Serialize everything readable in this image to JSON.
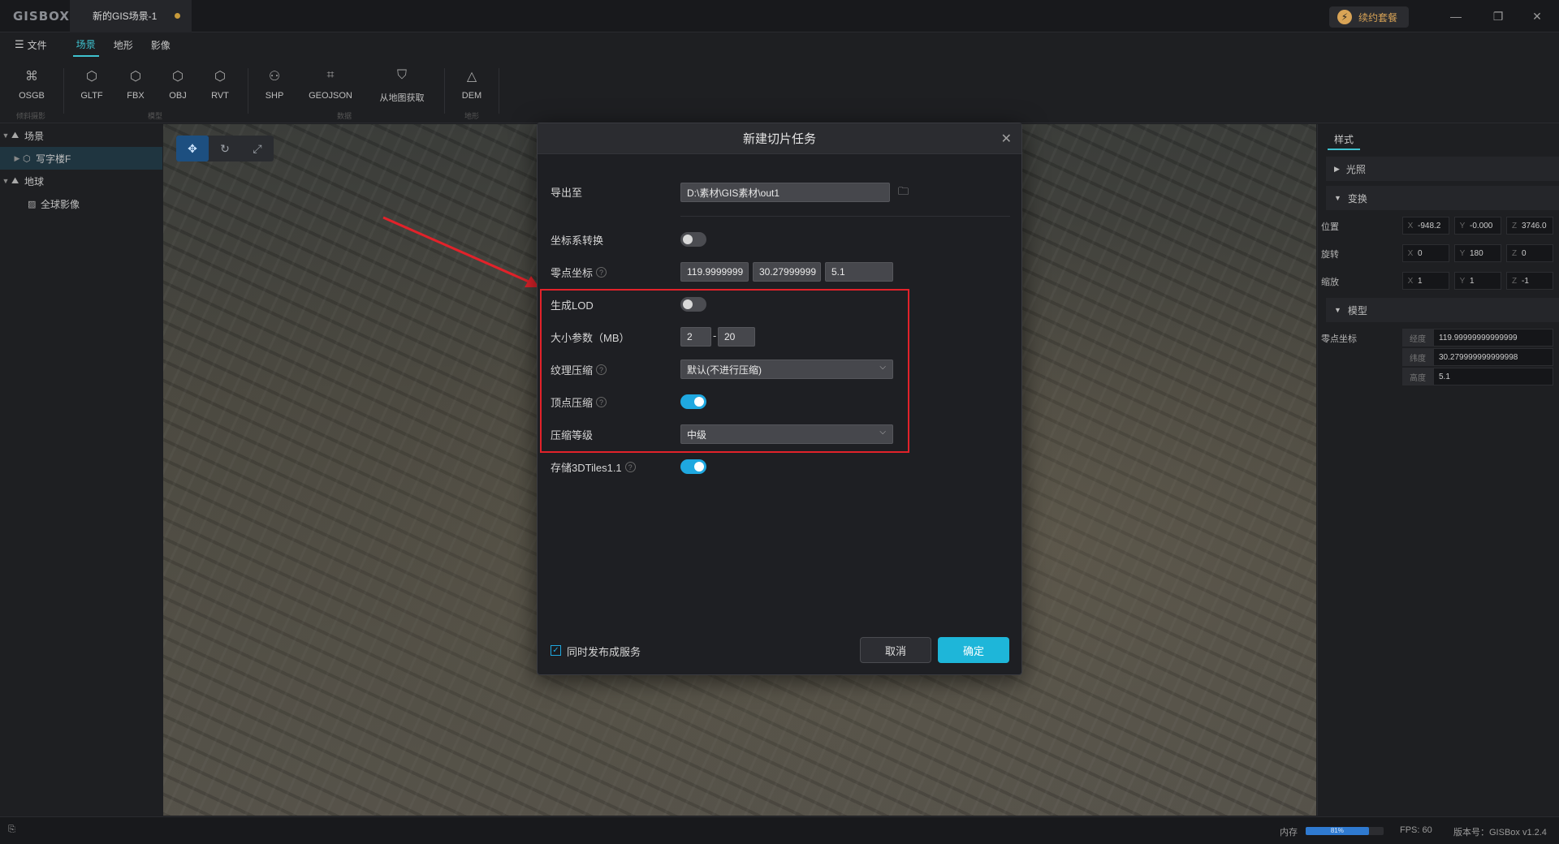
{
  "titlebar": {
    "logo": "GISBOX",
    "doc_tab": "新的GIS场景-1",
    "renew": "续约套餐",
    "minimize": "—",
    "restore": "❐",
    "close": "✕"
  },
  "menubar": {
    "file": "文件",
    "tabs": [
      "场景",
      "地形",
      "影像"
    ]
  },
  "toolbar": {
    "tools": [
      {
        "label": "OSGB",
        "icon": "tilt-model-icon"
      },
      {
        "label": "GLTF",
        "icon": "cube-icon"
      },
      {
        "label": "FBX",
        "icon": "cube-icon"
      },
      {
        "label": "OBJ",
        "icon": "cube-icon"
      },
      {
        "label": "RVT",
        "icon": "cube-icon"
      },
      {
        "label": "SHP",
        "icon": "vector-icon"
      },
      {
        "label": "GEOJSON",
        "icon": "vector-icon"
      },
      {
        "label": "从地图获取",
        "icon": "map-icon"
      },
      {
        "label": "DEM",
        "icon": "terrain-icon"
      }
    ],
    "groups": [
      "倾斜摄影",
      "模型",
      "数据",
      "地形"
    ]
  },
  "tree": {
    "scene": "场景",
    "building": "写字楼F",
    "earth": "地球",
    "imagery": "全球影像"
  },
  "right_panel": {
    "tab": "样式",
    "sections": [
      "光照",
      "变换",
      "模型"
    ],
    "transform": {
      "position_label": "位置",
      "position": [
        "-948.2",
        "-0.000",
        "3746.0"
      ],
      "rotation_label": "旋转",
      "rotation": [
        "0",
        "180",
        "0"
      ],
      "scale_label": "缩放",
      "scale": [
        "1",
        "1",
        "-1"
      ]
    },
    "model": {
      "zero_label": "零点坐标",
      "lon_label": "经度",
      "lon": "119.99999999999999",
      "lat_label": "纬度",
      "lat": "30.279999999999998",
      "height_label": "高度",
      "height": "5.1"
    }
  },
  "modal": {
    "title": "新建切片任务",
    "export_label": "导出至",
    "export_path": "D:\\素材\\GIS素材\\out1",
    "crs_label": "坐标系转换",
    "zero_label": "零点坐标",
    "zero_x": "119.9999999",
    "zero_y": "30.27999999",
    "zero_z": "5.1",
    "lod_label": "生成LOD",
    "size_label": "大小参数（MB）",
    "size_min": "2",
    "size_max": "20",
    "texture_label": "纹理压缩",
    "texture_value": "默认(不进行压缩)",
    "vertex_label": "顶点压缩",
    "level_label": "压缩等级",
    "level_value": "中级",
    "store_label": "存储3DTiles1.1",
    "publish_label": "同时发布成服务",
    "cancel": "取消",
    "ok": "确定",
    "toggles": {
      "crs": false,
      "lod": false,
      "vertex": true,
      "store": true
    },
    "publish_checked": true
  },
  "status": {
    "memory_label": "内存",
    "memory_percent": 81,
    "memory_text": "81%",
    "fps": "FPS: 60",
    "version": "版本号：GISBox v1.2.4"
  },
  "colors": {
    "accent": "#1fa8e0",
    "highlight": "#e2222a"
  }
}
